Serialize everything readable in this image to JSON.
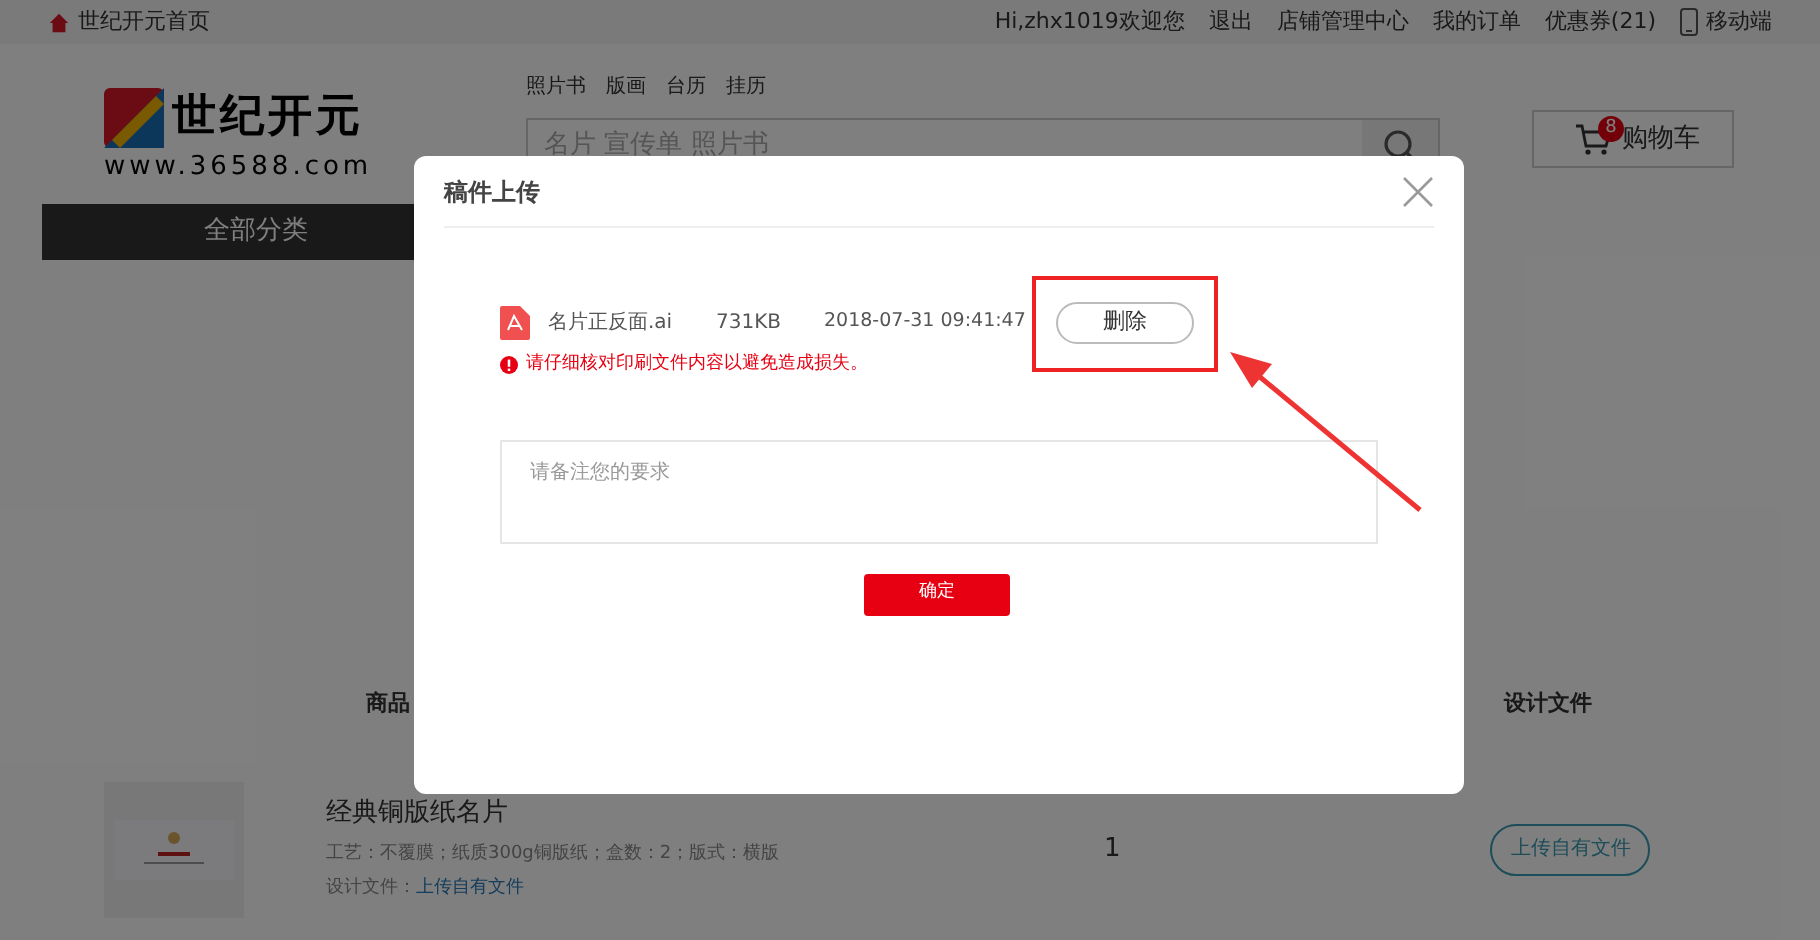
{
  "top_bar": {
    "home_link": "世纪开元首页",
    "greeting": "Hi,zhx1019欢迎您",
    "links": [
      "退出",
      "店铺管理中心",
      "我的订单",
      "优惠券(21)"
    ],
    "mobile": "移动端"
  },
  "header": {
    "logo": {
      "name": "世纪开元",
      "url": "www.36588.com"
    },
    "quick_links": [
      "照片书",
      "版画",
      "台历",
      "挂历"
    ],
    "search": {
      "placeholder": "名片 宣传单 照片书"
    },
    "cart": {
      "label": "购物车",
      "count": "8"
    }
  },
  "category_menu": {
    "label": "全部分类"
  },
  "table": {
    "columns": [
      "商品",
      "设计文件"
    ],
    "rows": [
      {
        "title": "经典铜版纸名片",
        "specs": "工艺：不覆膜；纸质300g铜版纸；盒数：2；版式：横版",
        "design_file_label": "设计文件：",
        "design_file_link": "上传自有文件",
        "quantity": "1",
        "upload_button": "上传自有文件"
      }
    ]
  },
  "dialog": {
    "title": "稿件上传",
    "file": {
      "name": "名片正反面.ai",
      "size": "731KB",
      "uploaded": "2018-07-31 09:41:47"
    },
    "delete_button": "删除",
    "warning": "请仔细核对印刷文件内容以避免造成损失。",
    "remark": {
      "placeholder": "请备注您的要求"
    },
    "confirm_button": "确定"
  }
}
